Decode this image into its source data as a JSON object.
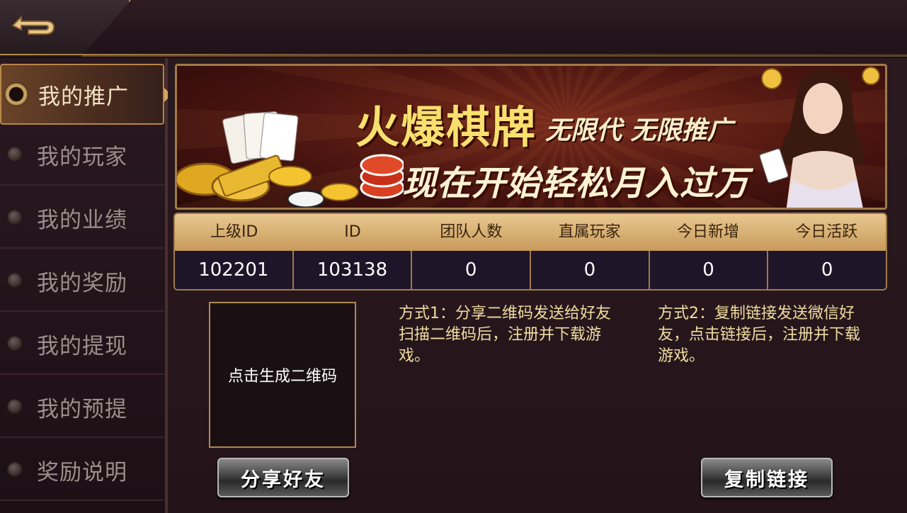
{
  "sidebar": {
    "items": [
      {
        "label": "我的推广",
        "active": true
      },
      {
        "label": "我的玩家"
      },
      {
        "label": "我的业绩"
      },
      {
        "label": "我的奖励"
      },
      {
        "label": "我的提现"
      },
      {
        "label": "我的预提"
      },
      {
        "label": "奖励说明"
      }
    ]
  },
  "banner": {
    "title": "火爆棋牌",
    "sub1": "无限代 无限推广",
    "sub2": "现在开始轻松月入过万"
  },
  "stats": {
    "headers": [
      "上级ID",
      "ID",
      "团队人数",
      "直属玩家",
      "今日新增",
      "今日活跃"
    ],
    "values": [
      "102201",
      "103138",
      "0",
      "0",
      "0",
      "0"
    ]
  },
  "qr": {
    "label": "点击生成二维码"
  },
  "methods": {
    "m1": "方式1：分享二维码发送给好友扫描二维码后，注册并下载游戏。",
    "m2": "方式2：复制链接发送微信好友，点击链接后，注册并下载游戏。"
  },
  "buttons": {
    "share": "分享好友",
    "copy": "复制链接"
  },
  "icons": {
    "back": "back-arrow-icon"
  },
  "colors": {
    "accent_gold": "#c89a5a",
    "text_gold": "#f0dca0",
    "bg": "#1c1014"
  }
}
